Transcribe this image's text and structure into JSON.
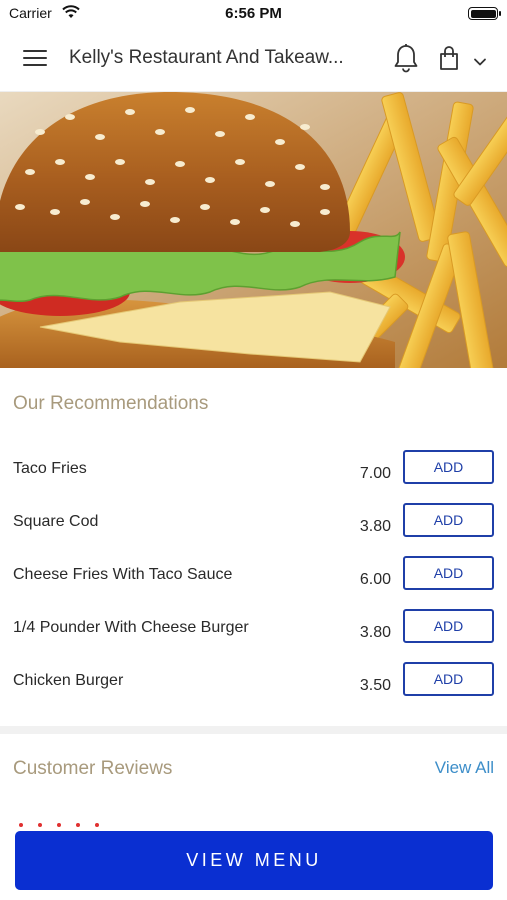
{
  "status_bar": {
    "carrier": "Carrier",
    "time": "6:56 PM"
  },
  "header": {
    "title": "Kelly's Restaurant And Takeaw...",
    "icons": [
      "menu-icon",
      "bell-icon",
      "bag-icon",
      "chevron-down-icon"
    ]
  },
  "recommendations": {
    "title": "Our Recommendations",
    "add_label": "ADD",
    "items": [
      {
        "name": "Taco Fries",
        "price": "7.00"
      },
      {
        "name": "Square Cod",
        "price": "3.80"
      },
      {
        "name": "Cheese Fries With Taco Sauce",
        "price": "6.00"
      },
      {
        "name": "1/4 Pounder With Cheese Burger",
        "price": "3.80"
      },
      {
        "name": "Chicken Burger",
        "price": "3.50"
      }
    ]
  },
  "reviews": {
    "title": "Customer Reviews",
    "view_all": "View All"
  },
  "footer": {
    "view_menu": "VIEW MENU"
  },
  "colors": {
    "accent_blue": "#0a2fd1",
    "add_button_blue": "#1f3fa8",
    "section_title": "#a89a7d",
    "link_blue": "#3d8ec9",
    "star_red": "#e03030"
  }
}
